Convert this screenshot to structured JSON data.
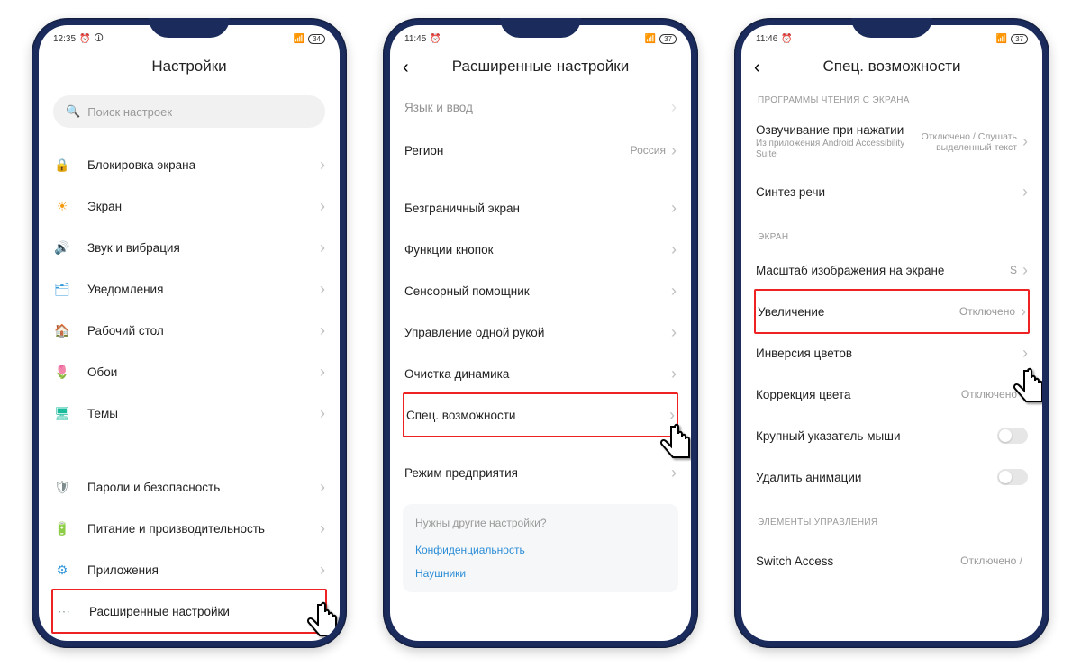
{
  "phone1": {
    "status": {
      "time": "12:35",
      "batt": "34"
    },
    "title": "Настройки",
    "search_placeholder": "Поиск настроек",
    "items": [
      {
        "label": "Блокировка экрана"
      },
      {
        "label": "Экран"
      },
      {
        "label": "Звук и вибрация"
      },
      {
        "label": "Уведомления"
      },
      {
        "label": "Рабочий стол"
      },
      {
        "label": "Обои"
      },
      {
        "label": "Темы"
      }
    ],
    "items2": [
      {
        "label": "Пароли и безопасность"
      },
      {
        "label": "Питание и производительность"
      },
      {
        "label": "Приложения"
      }
    ],
    "highlighted": "Расширенные настройки"
  },
  "phone2": {
    "status": {
      "time": "11:45",
      "batt": "37"
    },
    "title": "Расширенные настройки",
    "first_partial": "Язык и ввод",
    "region": {
      "label": "Регион",
      "value": "Россия"
    },
    "items": [
      {
        "label": "Безграничный экран"
      },
      {
        "label": "Функции кнопок"
      },
      {
        "label": "Сенсорный помощник"
      },
      {
        "label": "Управление одной рукой"
      },
      {
        "label": "Очистка динамика"
      }
    ],
    "highlighted": "Спец. возможности",
    "after": "Режим предприятия",
    "hint": {
      "title": "Нужны другие настройки?",
      "link1": "Конфиденциальность",
      "link2": "Наушники"
    }
  },
  "phone3": {
    "status": {
      "time": "11:46",
      "batt": "37"
    },
    "title": "Спец. возможности",
    "section1": "ПРОГРАММЫ ЧТЕНИЯ С ЭКРАНА",
    "talkback": {
      "label": "Озвучивание при нажатии",
      "sub": "Из приложения Android Accessibility Suite",
      "value": "Отключено / Слушать выделенный текст"
    },
    "tts": "Синтез речи",
    "section2": "ЭКРАН",
    "scale": {
      "label": "Масштаб изображения на экране",
      "value": "S"
    },
    "highlighted": {
      "label": "Увеличение",
      "value": "Отключено"
    },
    "inversion": "Инверсия цветов",
    "correction": {
      "label": "Коррекция цвета",
      "value": "Отключено"
    },
    "large_pointer": "Крупный указатель мыши",
    "remove_anim": "Удалить анимации",
    "section3": "ЭЛЕМЕНТЫ УПРАВЛЕНИЯ",
    "switch_access": {
      "label": "Switch Access",
      "value": "Отключено /"
    }
  }
}
